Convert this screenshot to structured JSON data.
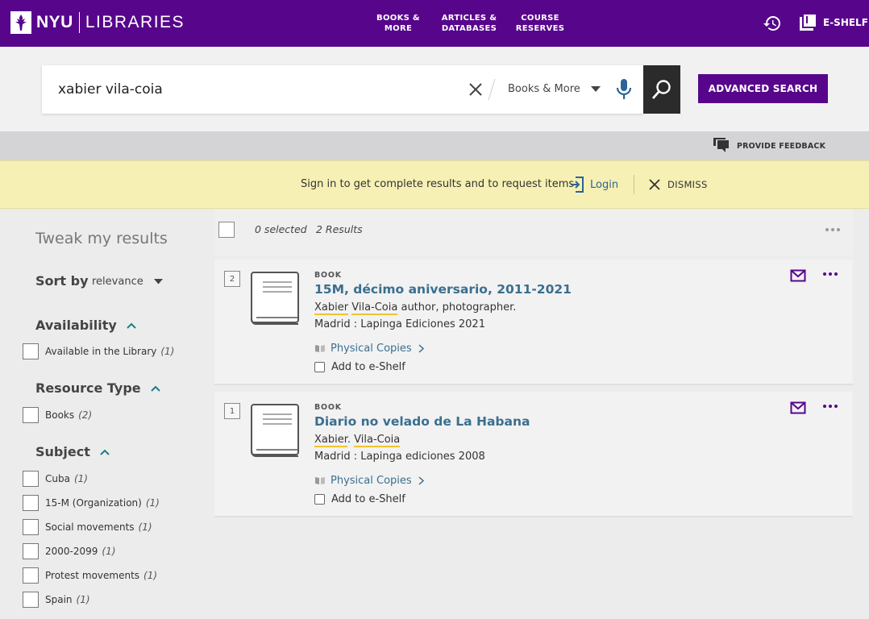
{
  "header": {
    "logo_nyu": "NYU",
    "logo_libraries": "LIBRARIES",
    "nav": [
      {
        "label": "BOOKS &\nMORE"
      },
      {
        "label": "ARTICLES &\nDATABASES"
      },
      {
        "label": "COURSE\nRESERVES"
      }
    ],
    "eshelf_label": "E-SHELF",
    "brand_color": "#57068c"
  },
  "search": {
    "query": "xabier vila-coia",
    "scope": "Books & More",
    "advanced_label": "ADVANCED SEARCH"
  },
  "feedback_label": "PROVIDE FEEDBACK",
  "banner": {
    "text": "Sign in to get complete results and to request items",
    "login_label": "Login",
    "dismiss_label": "DISMISS"
  },
  "sidebar": {
    "title": "Tweak my results",
    "sort_label": "Sort by",
    "sort_value": "relevance",
    "facets": [
      {
        "title": "Availability",
        "items": [
          {
            "label": "Available in the Library",
            "count": "(1)"
          }
        ]
      },
      {
        "title": "Resource Type",
        "items": [
          {
            "label": "Books",
            "count": "(2)"
          }
        ]
      },
      {
        "title": "Subject",
        "items": [
          {
            "label": "Cuba",
            "count": "(1)"
          },
          {
            "label": "15-M (Organization)",
            "count": "(1)"
          },
          {
            "label": "Social movements",
            "count": "(1)"
          },
          {
            "label": "2000-2099",
            "count": "(1)"
          },
          {
            "label": "Protest movements",
            "count": "(1)"
          },
          {
            "label": "Spain",
            "count": "(1)"
          }
        ]
      }
    ]
  },
  "results_header": {
    "selected": "0 selected",
    "count": "2 Results"
  },
  "results": [
    {
      "number": "2",
      "type": "BOOK",
      "title": "15M, décimo aniversario, 2011-2021",
      "author_first": "Xabier",
      "author_sep": " ",
      "author_last": "Vila-Coia",
      "author_rest": " author, photographer.",
      "publisher": "Madrid : Lapinga Ediciones 2021",
      "physical_label": "Physical Copies",
      "eshelf_label": "Add to e-Shelf"
    },
    {
      "number": "1",
      "type": "BOOK",
      "title": "Diario no velado de La Habana",
      "author_first": "Xabier",
      "author_sep": ". ",
      "author_last": "Vila-Coia",
      "author_rest": "",
      "publisher": "Madrid : Lapinga ediciones 2008",
      "physical_label": "Physical Copies",
      "eshelf_label": "Add to e-Shelf"
    }
  ]
}
